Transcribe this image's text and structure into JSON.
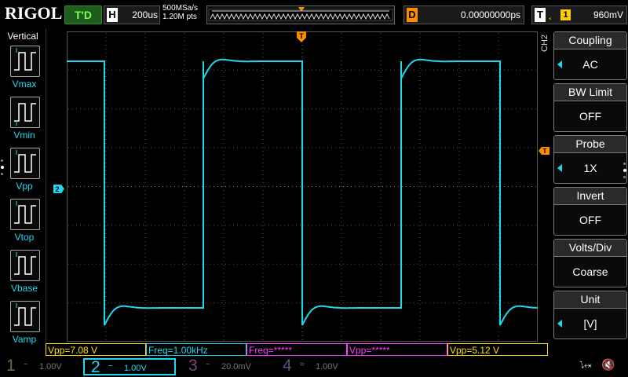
{
  "top_bar": {
    "logo": "RIGOL",
    "trigger_state": "T'D",
    "horizontal": {
      "key": "H",
      "value": "200us"
    },
    "sample_rate": "500MSa/s",
    "memory_depth": "1.20M pts",
    "delay": {
      "key": "D",
      "value": "0.00000000ps"
    },
    "trigger": {
      "key": "T",
      "edge_icon": "rising-edge-icon",
      "source": "1",
      "level": "960mV"
    }
  },
  "left_panel": {
    "title": "Vertical",
    "items": [
      {
        "label": "Vmax",
        "icon": "vmax-icon"
      },
      {
        "label": "Vmin",
        "icon": "vmin-icon"
      },
      {
        "label": "Vpp",
        "icon": "vpp-icon"
      },
      {
        "label": "Vtop",
        "icon": "vtop-icon"
      },
      {
        "label": "Vbase",
        "icon": "vbase-icon"
      },
      {
        "label": "Vamp",
        "icon": "vamp-icon"
      }
    ]
  },
  "right_menu": {
    "channel": "CH2",
    "items": [
      {
        "title": "Coupling",
        "value": "AC",
        "has_arrow": true
      },
      {
        "title": "BW Limit",
        "value": "OFF",
        "has_arrow": false
      },
      {
        "title": "Probe",
        "value": "1X",
        "has_arrow": true
      },
      {
        "title": "Invert",
        "value": "OFF",
        "has_arrow": false
      },
      {
        "title": "Volts/Div",
        "value": "Coarse",
        "has_arrow": false
      },
      {
        "title": "Unit",
        "value": "[V]",
        "has_arrow": true
      }
    ]
  },
  "measurements": [
    {
      "text": "Vpp=7.08 V",
      "color": "#ffe000"
    },
    {
      "text": "Freq=1.00kHz",
      "color": "#1fd8f0"
    },
    {
      "text": "Freq=*****",
      "color": "#ff3cff"
    },
    {
      "text": "Vpp=*****",
      "color": "#ff3cff"
    },
    {
      "text": "Vpp=5.12 V",
      "color": "#ffe000"
    }
  ],
  "channels": [
    {
      "num": "1",
      "coupling": "~",
      "scale": "1.00V",
      "color": "#6a6a4a",
      "active": false
    },
    {
      "num": "2",
      "coupling": "~",
      "scale": "1.00V",
      "color": "#1fd8f0",
      "active": true
    },
    {
      "num": "3",
      "coupling": "~",
      "scale": "20.0mV",
      "color": "#7a4a7a",
      "active": false
    },
    {
      "num": "4",
      "coupling": "=",
      "scale": "1.00V",
      "color": "#4a5a7a",
      "active": false
    }
  ],
  "markers": {
    "ch2_ground": "2",
    "trigger_pos": "T"
  },
  "colors": {
    "trace": "#1fd8f0",
    "trigger": "#ff8c00",
    "grid": "#3a3a3a"
  }
}
